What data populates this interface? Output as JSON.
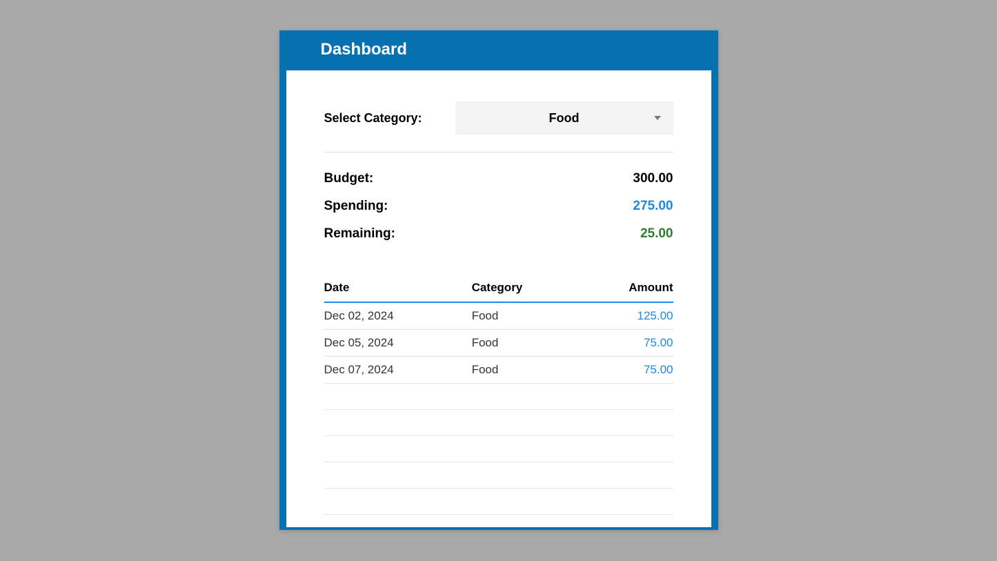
{
  "header": {
    "title": "Dashboard"
  },
  "selector": {
    "label": "Select Category:",
    "selected": "Food"
  },
  "summary": {
    "budget_label": "Budget:",
    "budget_value": "300.00",
    "spending_label": "Spending:",
    "spending_value": "275.00",
    "remaining_label": "Remaining:",
    "remaining_value": "25.00"
  },
  "table": {
    "columns": {
      "date": "Date",
      "category": "Category",
      "amount": "Amount"
    },
    "rows": [
      {
        "date": "Dec 02, 2024",
        "category": "Food",
        "amount": "125.00"
      },
      {
        "date": "Dec 05, 2024",
        "category": "Food",
        "amount": "75.00"
      },
      {
        "date": "Dec 07, 2024",
        "category": "Food",
        "amount": "75.00"
      }
    ]
  }
}
